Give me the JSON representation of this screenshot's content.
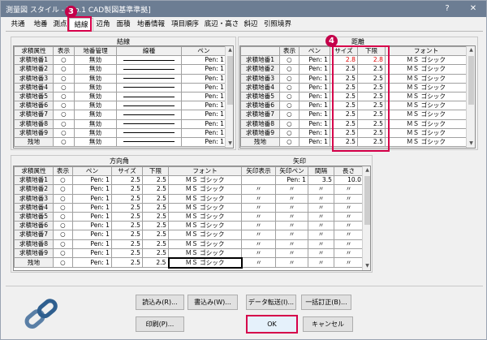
{
  "window": {
    "title": "測量図 スタイル - [No.1 CAD製図基準準拠]",
    "help": "?",
    "close": "✕"
  },
  "tabs": [
    "共通",
    "地番",
    "測点",
    "結線",
    "辺角",
    "面積",
    "地番情報",
    "項目順序",
    "底辺・高さ",
    "斜辺",
    "引照境界"
  ],
  "markers": {
    "m3": "3",
    "m4": "4"
  },
  "kessen": {
    "title": "結線",
    "headers": [
      "求積属性",
      "表示",
      "地番管理",
      "線種",
      "ペン"
    ],
    "rows": [
      {
        "attr": "求積地番1",
        "show": "○",
        "mgmt": "無効",
        "pen": "Pen: 1"
      },
      {
        "attr": "求積地番2",
        "show": "○",
        "mgmt": "無効",
        "pen": "Pen: 1"
      },
      {
        "attr": "求積地番3",
        "show": "○",
        "mgmt": "無効",
        "pen": "Pen: 1"
      },
      {
        "attr": "求積地番4",
        "show": "○",
        "mgmt": "無効",
        "pen": "Pen: 1"
      },
      {
        "attr": "求積地番5",
        "show": "○",
        "mgmt": "無効",
        "pen": "Pen: 1"
      },
      {
        "attr": "求積地番6",
        "show": "○",
        "mgmt": "無効",
        "pen": "Pen: 1"
      },
      {
        "attr": "求積地番7",
        "show": "○",
        "mgmt": "無効",
        "pen": "Pen: 1"
      },
      {
        "attr": "求積地番8",
        "show": "○",
        "mgmt": "無効",
        "pen": "Pen: 1"
      },
      {
        "attr": "求積地番9",
        "show": "○",
        "mgmt": "無効",
        "pen": "Pen: 1"
      },
      {
        "attr": "残地",
        "show": "○",
        "mgmt": "無効",
        "pen": "Pen: 1"
      }
    ]
  },
  "kyori": {
    "title": "距離",
    "headers": [
      "表示",
      "ペン",
      "サイズ",
      "下限",
      "フォント"
    ],
    "rows": [
      {
        "attr": "求積地番1",
        "show": "○",
        "pen": "Pen: 1",
        "size": "2.8",
        "lower": "2.8",
        "font": "ＭＳ ゴシック",
        "red": true
      },
      {
        "attr": "求積地番2",
        "show": "○",
        "pen": "Pen: 1",
        "size": "2.5",
        "lower": "2.5",
        "font": "ＭＳ ゴシック"
      },
      {
        "attr": "求積地番3",
        "show": "○",
        "pen": "Pen: 1",
        "size": "2.5",
        "lower": "2.5",
        "font": "ＭＳ ゴシック"
      },
      {
        "attr": "求積地番4",
        "show": "○",
        "pen": "Pen: 1",
        "size": "2.5",
        "lower": "2.5",
        "font": "ＭＳ ゴシック"
      },
      {
        "attr": "求積地番5",
        "show": "○",
        "pen": "Pen: 1",
        "size": "2.5",
        "lower": "2.5",
        "font": "ＭＳ ゴシック"
      },
      {
        "attr": "求積地番6",
        "show": "○",
        "pen": "Pen: 1",
        "size": "2.5",
        "lower": "2.5",
        "font": "ＭＳ ゴシック"
      },
      {
        "attr": "求積地番7",
        "show": "○",
        "pen": "Pen: 1",
        "size": "2.5",
        "lower": "2.5",
        "font": "ＭＳ ゴシック"
      },
      {
        "attr": "求積地番8",
        "show": "○",
        "pen": "Pen: 1",
        "size": "2.5",
        "lower": "2.5",
        "font": "ＭＳ ゴシック"
      },
      {
        "attr": "求積地番9",
        "show": "○",
        "pen": "Pen: 1",
        "size": "2.5",
        "lower": "2.5",
        "font": "ＭＳ ゴシック"
      },
      {
        "attr": "残地",
        "show": "○",
        "pen": "Pen: 1",
        "size": "2.5",
        "lower": "2.5",
        "font": "ＭＳ ゴシック"
      }
    ]
  },
  "houikaku": {
    "title": "方向角",
    "headers": [
      "求積属性",
      "表示",
      "ペン",
      "サイズ",
      "下限",
      "フォント"
    ],
    "rows": [
      {
        "attr": "求積地番1",
        "show": "○",
        "pen": "Pen: 1",
        "size": "2.5",
        "lower": "2.5",
        "font": "ＭＳ ゴシック"
      },
      {
        "attr": "求積地番2",
        "show": "○",
        "pen": "Pen: 1",
        "size": "2.5",
        "lower": "2.5",
        "font": "ＭＳ ゴシック"
      },
      {
        "attr": "求積地番3",
        "show": "○",
        "pen": "Pen: 1",
        "size": "2.5",
        "lower": "2.5",
        "font": "ＭＳ ゴシック"
      },
      {
        "attr": "求積地番4",
        "show": "○",
        "pen": "Pen: 1",
        "size": "2.5",
        "lower": "2.5",
        "font": "ＭＳ ゴシック"
      },
      {
        "attr": "求積地番5",
        "show": "○",
        "pen": "Pen: 1",
        "size": "2.5",
        "lower": "2.5",
        "font": "ＭＳ ゴシック"
      },
      {
        "attr": "求積地番6",
        "show": "○",
        "pen": "Pen: 1",
        "size": "2.5",
        "lower": "2.5",
        "font": "ＭＳ ゴシック"
      },
      {
        "attr": "求積地番7",
        "show": "○",
        "pen": "Pen: 1",
        "size": "2.5",
        "lower": "2.5",
        "font": "ＭＳ ゴシック"
      },
      {
        "attr": "求積地番8",
        "show": "○",
        "pen": "Pen: 1",
        "size": "2.5",
        "lower": "2.5",
        "font": "ＭＳ ゴシック"
      },
      {
        "attr": "求積地番9",
        "show": "○",
        "pen": "Pen: 1",
        "size": "2.5",
        "lower": "2.5",
        "font": "ＭＳ ゴシック"
      },
      {
        "attr": "残地",
        "show": "○",
        "pen": "Pen: 1",
        "size": "2.5",
        "lower": "2.5",
        "font": "ＭＳ ゴシック"
      }
    ]
  },
  "yajirushi": {
    "title": "矢印",
    "headers": [
      "矢印表示",
      "矢印ペン",
      "間隔",
      "長さ"
    ],
    "first": {
      "show": "",
      "pen": "Pen: 1",
      "gap": "3.5",
      "len": "10.0"
    },
    "ditto": "〃"
  },
  "buttons": {
    "load": "読込み(R)...",
    "save": "書込み(W)...",
    "transfer": "データ転送(I)...",
    "fix": "一括訂正(B)...",
    "print": "印刷(P)...",
    "ok": "OK",
    "cancel": "キャンセル"
  }
}
